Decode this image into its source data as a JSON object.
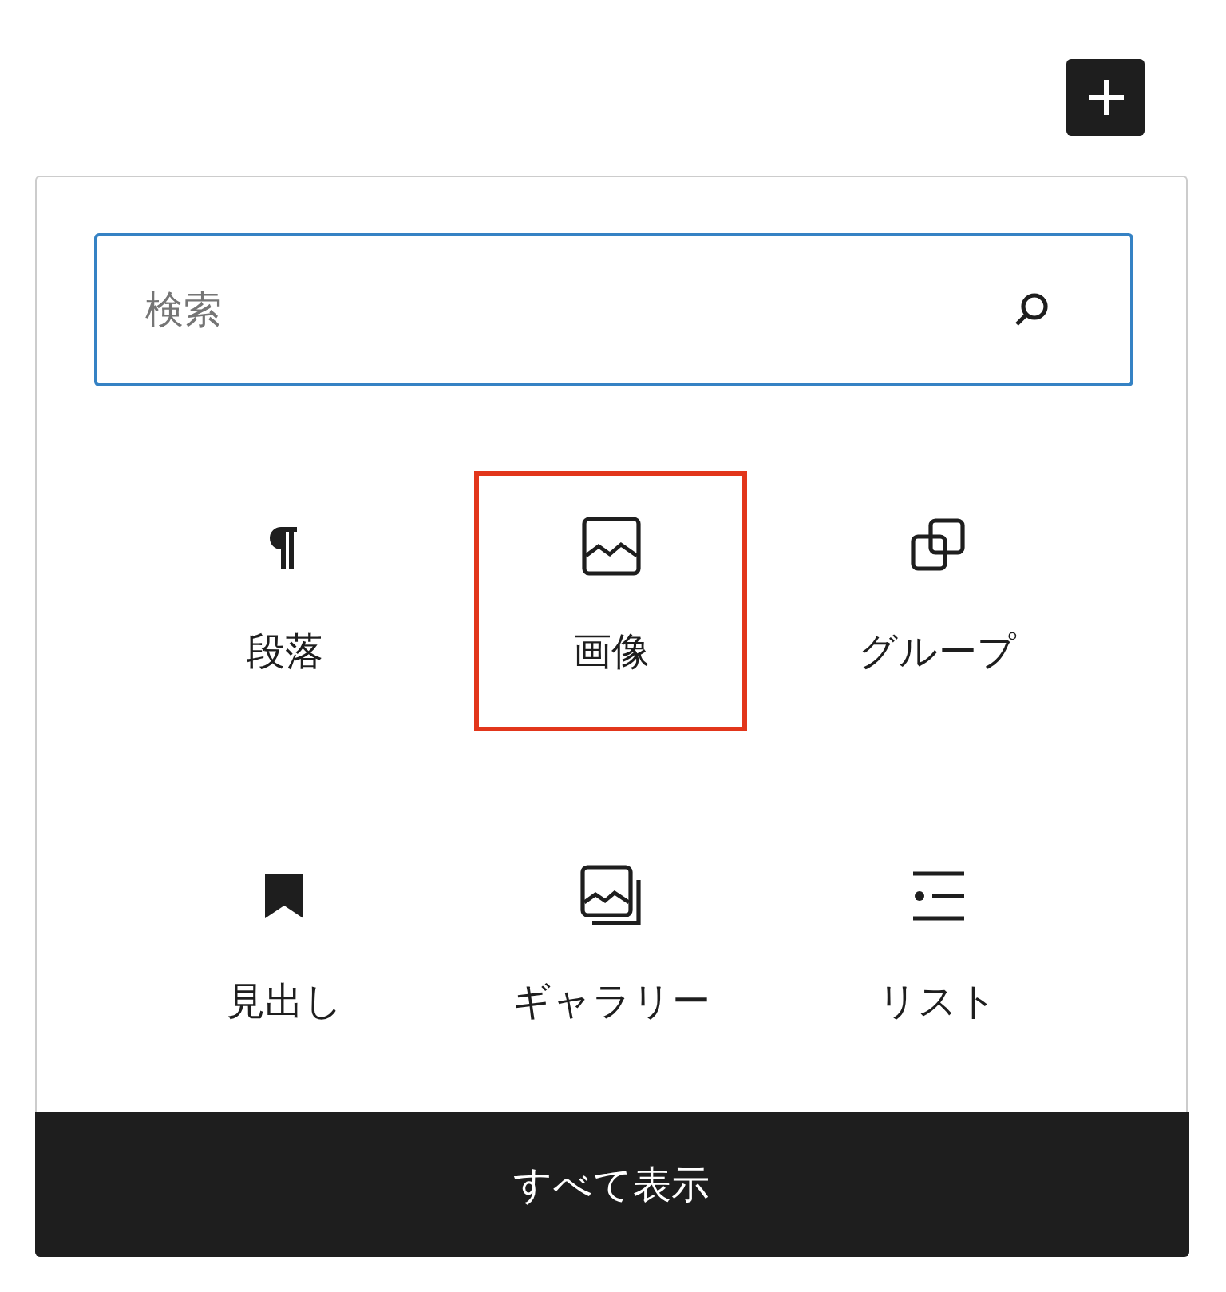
{
  "search": {
    "placeholder": "検索"
  },
  "blocks": [
    {
      "kind": "paragraph",
      "label": "段落",
      "highlighted": false
    },
    {
      "kind": "image",
      "label": "画像",
      "highlighted": true
    },
    {
      "kind": "group",
      "label": "グループ",
      "highlighted": false
    },
    {
      "kind": "heading",
      "label": "見出し",
      "highlighted": false
    },
    {
      "kind": "gallery",
      "label": "ギャラリー",
      "highlighted": false
    },
    {
      "kind": "list",
      "label": "リスト",
      "highlighted": false
    }
  ],
  "footer_button": "すべて表示"
}
